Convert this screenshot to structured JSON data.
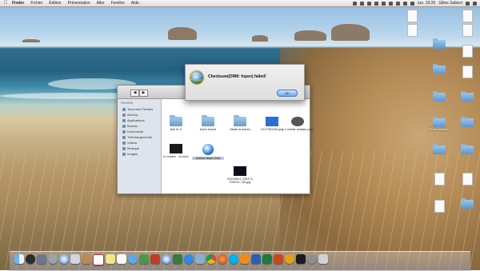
{
  "menubar": {
    "apple": "",
    "items": [
      "Finder",
      "Fichier",
      "Édition",
      "Présentation",
      "Aller",
      "Fenêtre",
      "Aide"
    ],
    "clock": "lun. 19:25",
    "user": "Gilles Salbert"
  },
  "dialog": {
    "message": "Checksum(DRM: fopen) failed!",
    "ok_label": "OK"
  },
  "finder": {
    "sidebar_header": "FAVORIS",
    "sidebar_items": [
      "Tous mes Fichiers",
      "AirDrop",
      "Applications",
      "Bureau",
      "Documents",
      "Téléchargements",
      "Vidéos",
      "Musique",
      "Images"
    ],
    "items": [
      {
        "label": "jbts 01.0",
        "kind": "folder"
      },
      {
        "label": "Autre boulot",
        "kind": "folder"
      },
      {
        "label": "Skate et autres",
        "kind": "folder"
      },
      {
        "label": "1217780150.png",
        "kind": "file"
      },
      {
        "label": "L1 mobile avatare.png",
        "kind": "file"
      },
      {
        "label": "to chaine ...to.mp4",
        "kind": "movie"
      },
      {
        "label": "Marble Blast Gold",
        "kind": "app"
      },
      {
        "label": "20100614_235174 919031...55.jpg",
        "kind": "image"
      }
    ]
  },
  "desktop_icons": [
    "",
    "",
    "",
    "",
    "",
    "",
    "",
    "",
    "",
    "",
    "",
    "",
    "",
    "",
    "",
    "",
    "Photos Sélection",
    "",
    "",
    "",
    "",
    "",
    "",
    "",
    "",
    ""
  ],
  "dock": {
    "apps": [
      "Finder",
      "Dashboard",
      "Mission Control",
      "Launchpad",
      "Safari",
      "Mail",
      "Contacts",
      "Calendar",
      "Notes",
      "Reminders",
      "Messages",
      "FaceTime",
      "Photo Booth",
      "iTunes",
      "iPhoto",
      "App Store",
      "Preview",
      "Chrome",
      "Firefox",
      "Skype",
      "VLC",
      "Word",
      "Excel",
      "PowerPoint",
      "Outlook",
      "Terminal",
      "Settings",
      "Trash"
    ]
  }
}
